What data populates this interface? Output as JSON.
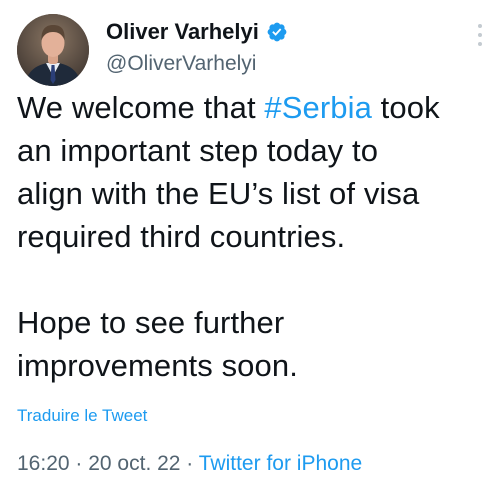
{
  "author": {
    "display_name": "Oliver Varhelyi",
    "handle": "@OliverVarhelyi",
    "verified": true,
    "avatar_icon": "profile-photo-icon",
    "verified_icon": "verified-badge-icon"
  },
  "menu": {
    "icon": "more-options-vertical-icon"
  },
  "tweet": {
    "line1_before": "We welcome that ",
    "hashtag": "#Serbia",
    "line1_after": " took",
    "line2": "an important step today to",
    "line3": "align with the EU’s list of visa",
    "line4": "required third countries.",
    "line5": "Hope to see further",
    "line6": "improvements soon."
  },
  "translate_label": "Traduire le Tweet",
  "meta": {
    "time": "16:20",
    "separator": " · ",
    "date": "20 oct. 22",
    "source": "Twitter for iPhone"
  },
  "colors": {
    "link": "#1d9bf0",
    "secondary_text": "#536471",
    "primary_text": "#0f1419"
  }
}
